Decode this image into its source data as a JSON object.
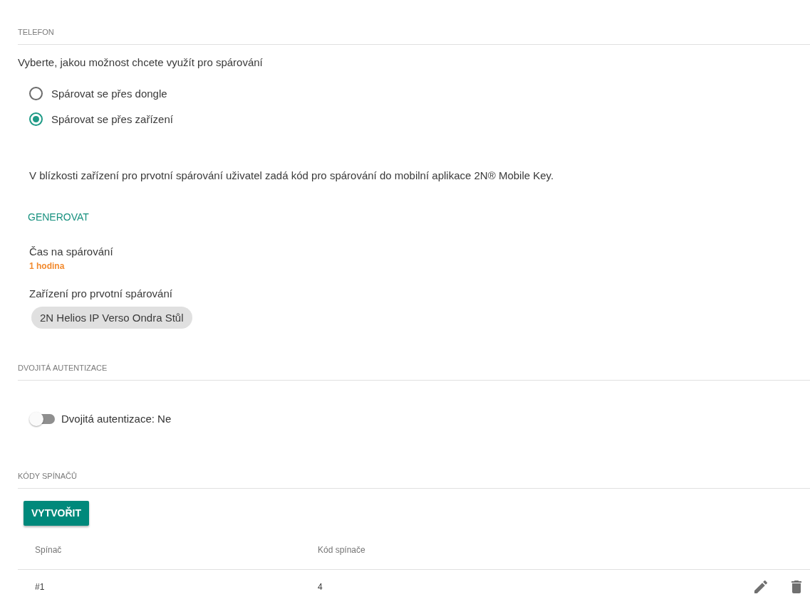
{
  "phone": {
    "heading": "TELEFON",
    "prompt": "Vyberte, jakou možnost chcete využít pro spárování",
    "pairing_options": [
      {
        "label": "Spárovat se přes dongle",
        "selected": false
      },
      {
        "label": "Spárovat se přes zařízení",
        "selected": true
      }
    ],
    "description": "V blízkosti zařízení pro prvotní spárování uživatel zadá kód pro spárování do mobilní aplikace 2N® Mobile Key.",
    "generate_button": "GENEROVAT",
    "pairing_time": {
      "label": "Čas na spárování",
      "value": "1 hodina"
    },
    "pairing_device": {
      "label": "Zařízení pro prvotní spárování",
      "chip": "2N Helios IP Verso Ondra Stůl"
    }
  },
  "two_factor": {
    "heading": "DVOJITÁ AUTENTIZACE",
    "toggle": {
      "label": "Dvojitá autentizace: Ne",
      "on": false
    }
  },
  "switch_codes": {
    "heading": "KÓDY SPÍNAČŮ",
    "create_button": "VYTVOŘIT",
    "table": {
      "columns": [
        "Spínač",
        "Kód spínače"
      ],
      "rows": [
        {
          "cells": [
            "#1",
            "4"
          ]
        }
      ]
    }
  }
}
